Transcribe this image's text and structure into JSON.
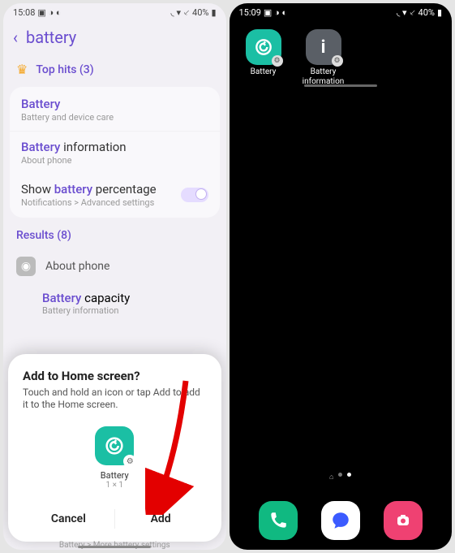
{
  "left": {
    "status": {
      "time": "15:08",
      "battery": "40%"
    },
    "search": {
      "query": "battery"
    },
    "top_hits": {
      "label": "Top hits (3)",
      "items": [
        {
          "title_hl": "Battery",
          "title_rest": "",
          "sub": "Battery and device care"
        },
        {
          "title_hl": "Battery",
          "title_rest": " information",
          "sub": "About phone"
        },
        {
          "title_pre": "Show ",
          "title_hl": "battery",
          "title_post": " percentage",
          "sub": "Notifications > Advanced settings",
          "toggle": true
        }
      ]
    },
    "results": {
      "label": "Results (8)",
      "group_label": "About phone",
      "item": {
        "title_hl": "Battery",
        "title_rest": " capacity",
        "sub": "Battery information"
      }
    },
    "dialog": {
      "title": "Add to Home screen?",
      "text": "Touch and hold an icon or tap Add to add it to the Home screen.",
      "preview_label": "Battery",
      "preview_size": "1 × 1",
      "cancel": "Cancel",
      "add": "Add"
    },
    "faded_below": "Battery > More battery settings"
  },
  "right": {
    "status": {
      "time": "15:09",
      "battery": "40%"
    },
    "apps": [
      {
        "label": "Battery"
      },
      {
        "label": "Battery\ninformation"
      }
    ]
  }
}
